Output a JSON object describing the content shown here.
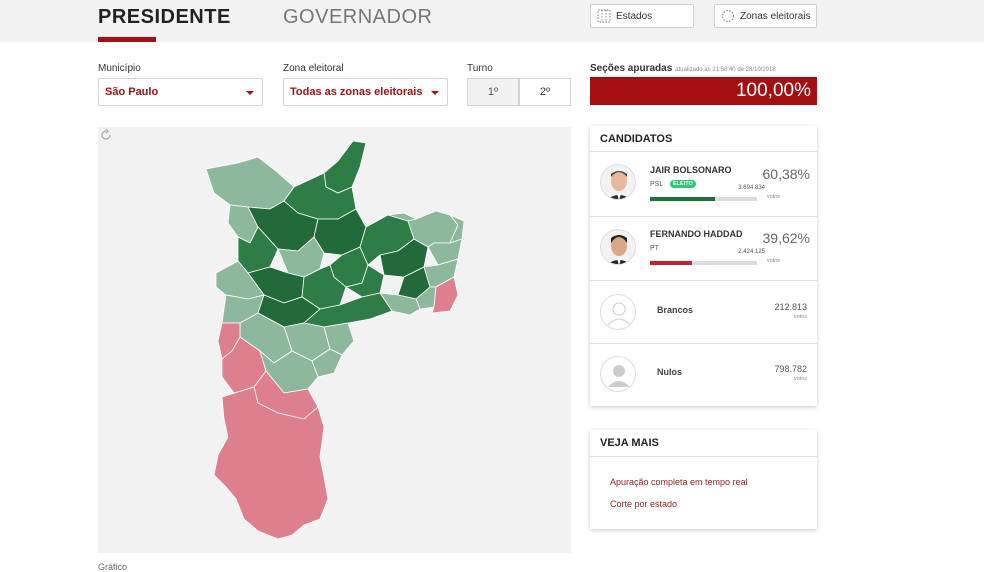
{
  "tabs": {
    "president": "PRESIDENTE",
    "governor": "GOVERNADOR"
  },
  "top_buttons": {
    "estados": "Estados",
    "zonas": "Zonas eleitorais"
  },
  "filters": {
    "municipio_label": "Município",
    "municipio_value": "São Paulo",
    "zona_label": "Zona eleitoral",
    "zona_value": "Todas as zonas eleitorais",
    "turno_label": "Turno",
    "turno_options": [
      "1º",
      "2º"
    ],
    "secoes_label": "Seções apuradas",
    "secoes_updated": "atualizado às 21:58:40 de 28/10/2018",
    "secoes_value": "100,00%"
  },
  "candidates_card": {
    "title": "CANDIDATOS",
    "candidates": [
      {
        "name": "JAIR BOLSONARO",
        "party": "PSL",
        "badge": "ELEITO",
        "pct": "60,38%",
        "votes": "3.694.834",
        "votes_label": "votos",
        "share": 0.6038,
        "color": "#1e6f3a"
      },
      {
        "name": "FERNANDO HADDAD",
        "party": "PT",
        "badge": "",
        "pct": "39,62%",
        "votes": "2.424.125",
        "votes_label": "votos",
        "share": 0.3962,
        "color": "#c3203a"
      }
    ],
    "others": [
      {
        "name": "Brancos",
        "votes": "212.813",
        "votes_label": "votos"
      },
      {
        "name": "Nulos",
        "votes": "798.782",
        "votes_label": "votos"
      }
    ]
  },
  "veja_mais": {
    "title": "VEJA MAIS",
    "links": [
      "Apuração completa em tempo real",
      "Corte por estado"
    ]
  },
  "footer_fragment": "Gráfico",
  "colors": {
    "accent": "#a50f12",
    "bolsonaro_strong": "#1e6f3a",
    "bolsonaro_light": "#8eb89b",
    "haddad": "#de7f8e"
  }
}
